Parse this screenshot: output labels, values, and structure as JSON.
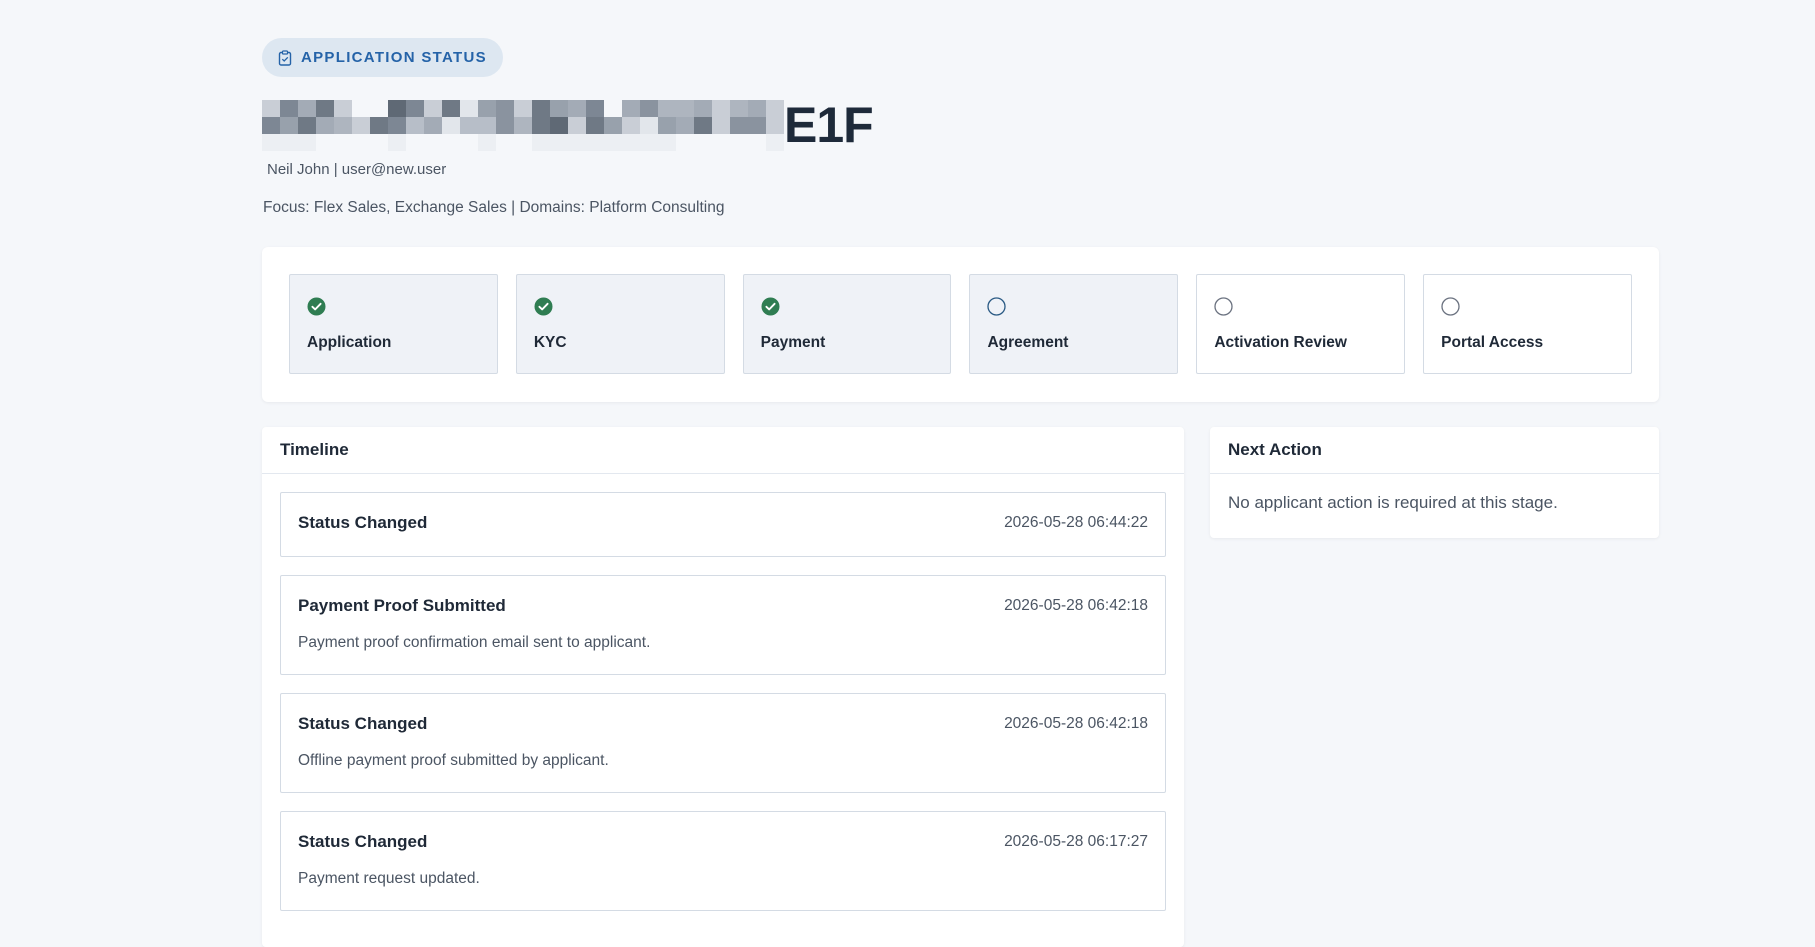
{
  "header": {
    "badge_label": "APPLICATION STATUS",
    "badge_icon": "clipboard-check-icon",
    "title_visible_suffix": "E1F",
    "applicant_line": "Neil John | user@new.user",
    "focus_line": "Focus: Flex Sales, Exchange Sales | Domains: Platform Consulting"
  },
  "colors": {
    "accent": "#2563a8",
    "complete": "#2f7d52",
    "pending_current": "#2a5a84",
    "pending": "#6b7280"
  },
  "stages": [
    {
      "label": "Application",
      "status": "complete"
    },
    {
      "label": "KYC",
      "status": "complete"
    },
    {
      "label": "Payment",
      "status": "complete"
    },
    {
      "label": "Agreement",
      "status": "current"
    },
    {
      "label": "Activation Review",
      "status": "pending"
    },
    {
      "label": "Portal Access",
      "status": "pending"
    }
  ],
  "timeline": {
    "heading": "Timeline",
    "events": [
      {
        "title": "Status Changed",
        "time": "2026-05-28 06:44:22",
        "desc": ""
      },
      {
        "title": "Payment Proof Submitted",
        "time": "2026-05-28 06:42:18",
        "desc": "Payment proof confirmation email sent to applicant."
      },
      {
        "title": "Status Changed",
        "time": "2026-05-28 06:42:18",
        "desc": "Offline payment proof submitted by applicant."
      },
      {
        "title": "Status Changed",
        "time": "2026-05-28 06:17:27",
        "desc": "Payment request updated."
      }
    ]
  },
  "next_action": {
    "heading": "Next Action",
    "message": "No applicant action is required at this stage."
  }
}
